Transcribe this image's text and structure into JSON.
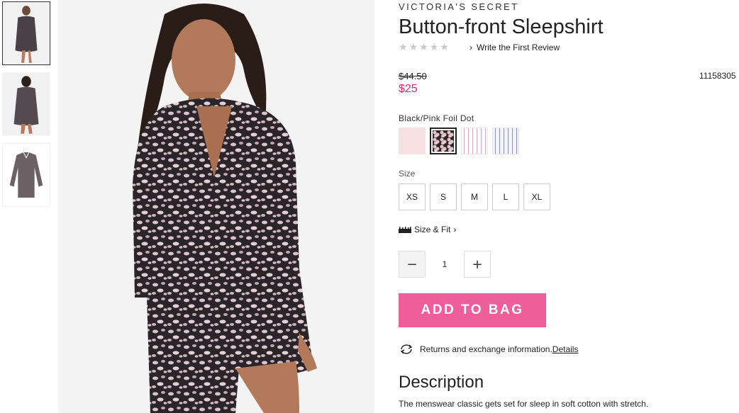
{
  "brand": "VICTORIA'S SECRET",
  "product": {
    "title": "Button-front Sleepshirt",
    "rating_stars": 5,
    "review_link": "Write the First Review",
    "price_was": "$44.50",
    "price_now": "$25",
    "sku": "11158305"
  },
  "color": {
    "selected_label": "Black/Pink Foil Dot",
    "swatches": [
      "pink",
      "black-pink-dot",
      "pink-stripe",
      "blue-stripe"
    ],
    "selected_index": 1
  },
  "size": {
    "label": "Size",
    "options": [
      "XS",
      "S",
      "M",
      "L",
      "XL"
    ]
  },
  "size_fit": {
    "label": "Size & Fit"
  },
  "quantity": {
    "value": "1",
    "minus": "−",
    "plus": "+"
  },
  "add_to_bag": "ADD TO BAG",
  "returns": {
    "text": "Returns and exchange information.",
    "link": "Details"
  },
  "description": {
    "heading": "Description",
    "text": "The menswear classic gets set for sleep in soft cotton with stretch."
  },
  "colors": {
    "price_sale": "#d72b6b",
    "cta": "#ee5e9a"
  }
}
